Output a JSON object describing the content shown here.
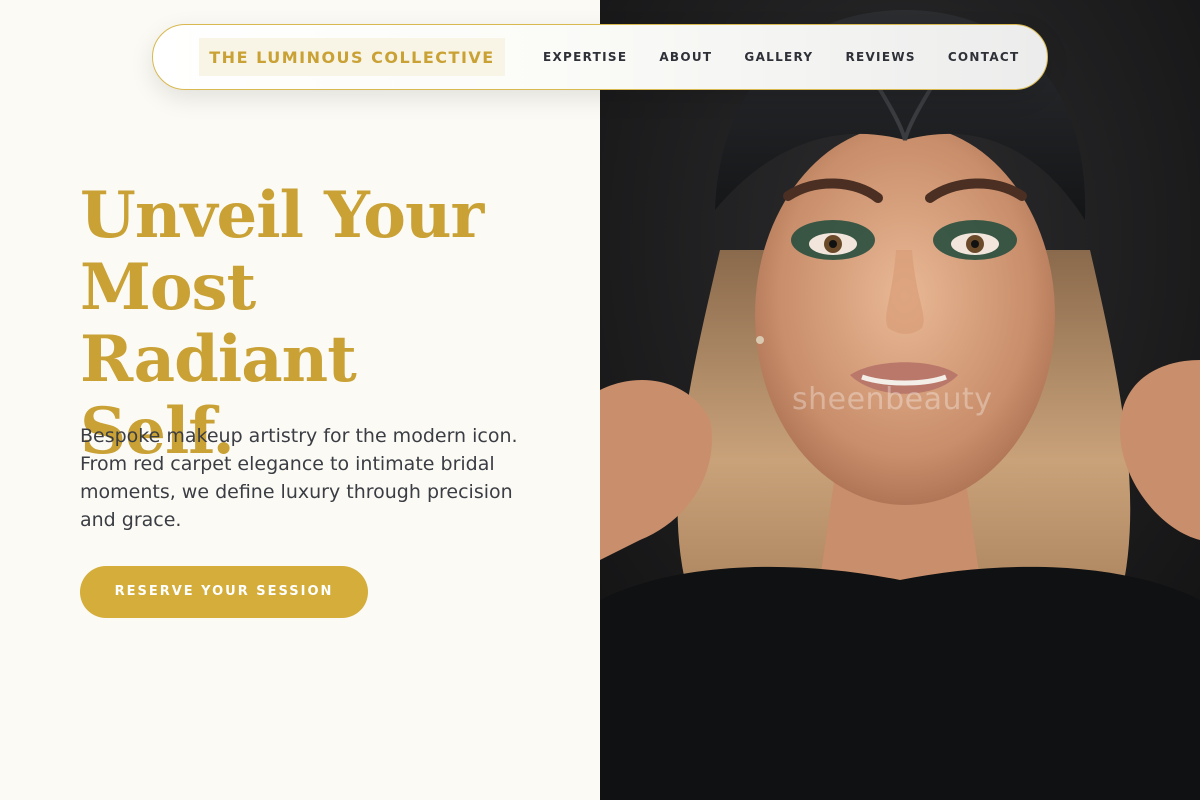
{
  "nav": {
    "brand": "THE LUMINOUS COLLECTIVE",
    "links": [
      "EXPERTISE",
      "ABOUT",
      "GALLERY",
      "REVIEWS",
      "CONTACT"
    ]
  },
  "hero": {
    "headline_lines": [
      "Unveil Your",
      "Most Radiant",
      "Self."
    ],
    "description": "Bespoke makeup artistry for the modern icon. From red carpet elegance to intimate bridal moments, we define luxury through precision and grace.",
    "cta_label": "RESERVE YOUR SESSION"
  },
  "photo": {
    "watermark": "sheenbeauty"
  },
  "colors": {
    "gold": "#c9a134",
    "button_gold": "#d4ad3a",
    "background": "#fbfaf4",
    "text_dark": "#3b3d44"
  }
}
